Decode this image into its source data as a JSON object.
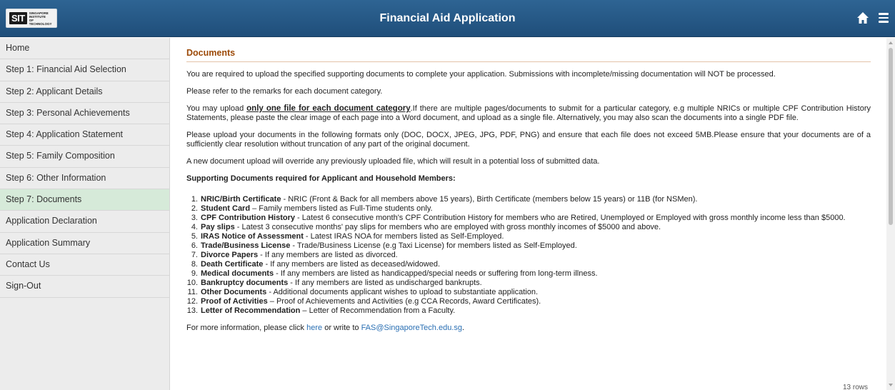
{
  "header": {
    "logo_mark": "SIT",
    "logo_text": "SINGAPORE INSTITUTE OF TECHNOLOGY",
    "title": "Financial Aid Application",
    "home_icon": "home-icon",
    "menu_icon": "hamburger-menu-icon",
    "colors": {
      "bar": "#2a5c8a",
      "title_text": "#ffffff"
    }
  },
  "sidebar": {
    "items": [
      {
        "label": "Home",
        "active": false
      },
      {
        "label": "Step 1: Financial Aid Selection",
        "active": false
      },
      {
        "label": "Step 2: Applicant Details",
        "active": false
      },
      {
        "label": "Step 3: Personal Achievements",
        "active": false
      },
      {
        "label": "Step 4: Application Statement",
        "active": false
      },
      {
        "label": "Step 5: Family Composition",
        "active": false
      },
      {
        "label": "Step 6: Other Information",
        "active": false
      },
      {
        "label": "Step 7: Documents",
        "active": true
      },
      {
        "label": "Application Declaration",
        "active": false
      },
      {
        "label": "Application Summary",
        "active": false
      },
      {
        "label": "Contact Us",
        "active": false
      },
      {
        "label": "Sign-Out",
        "active": false
      }
    ],
    "colors": {
      "background": "#ececec",
      "active": "#d6ead9"
    }
  },
  "main": {
    "section_title": "Documents",
    "p1": "You are required to upload the specified supporting documents to complete your application. Submissions with incomplete/missing documentation will NOT be processed.",
    "p2": "Please refer to the remarks for each document category.",
    "p3_pre": "You may upload ",
    "p3_bold": "only one file for each document category",
    "p3_post": ".If there are multiple pages/documents to submit for a particular category, e.g multiple NRICs or multiple CPF Contribution History Statements, please paste the clear image of each page into a Word document, and upload as a single file. Alternatively, you may also scan the documents into a single PDF file.",
    "p4": "Please upload your documents in the following formats only (DOC, DOCX, JPEG, JPG, PDF, PNG) and ensure that each file does not exceed 5MB.Please ensure that your documents are of a sufficiently clear resolution without truncation of any part of the original document.",
    "p5": "A new document upload will override any previously uploaded file, which will result in a potential loss of submitted data.",
    "list_heading": "Supporting Documents required for Applicant and Household Members:",
    "documents": [
      {
        "num": "1.",
        "name": "NRIC/Birth Certificate",
        "desc": " - NRIC (Front & Back for all members above 15 years), Birth Certificate (members below 15 years) or 11B (for NSMen)."
      },
      {
        "num": "2.",
        "name": "Student Card",
        "desc": " – Family members listed as Full-Time students only."
      },
      {
        "num": "3.",
        "name": "CPF Contribution History",
        "desc": " - Latest 6 consecutive month's CPF Contribution History for members who are Retired, Unemployed or Employed with gross monthly income less than $5000."
      },
      {
        "num": "4.",
        "name": "Pay slips",
        "desc": " - Latest 3 consecutive months' pay slips for members who are employed with gross monthly incomes of $5000 and above."
      },
      {
        "num": "5.",
        "name": "IRAS Notice of Assessment",
        "desc": " - Latest IRAS NOA for members listed as Self-Employed."
      },
      {
        "num": "6.",
        "name": "Trade/Business License",
        "desc": " - Trade/Business License (e.g Taxi License) for members listed as Self-Employed."
      },
      {
        "num": "7.",
        "name": "Divorce Papers",
        "desc": " - If any members are listed as divorced."
      },
      {
        "num": "8.",
        "name": "Death Certificate",
        "desc": " - If any members are listed as deceased/widowed."
      },
      {
        "num": "9.",
        "name": "Medical documents",
        "desc": " - If any members are listed as handicapped/special needs or suffering from long-term illness."
      },
      {
        "num": "10.",
        "name": "Bankruptcy documents",
        "desc": " - If any members are listed as undischarged bankrupts."
      },
      {
        "num": "11.",
        "name": "Other Documents",
        "desc": " - Additional documents applicant wishes to upload to substantiate application."
      },
      {
        "num": "12.",
        "name": "Proof of Activities",
        "desc": " – Proof of Achievements and Activities (e.g CCA Records, Award Certificates)."
      },
      {
        "num": "13.",
        "name": "Letter of Recommendation",
        "desc": " – Letter of Recommendation from a Faculty."
      }
    ],
    "footer_pre": "For more information, please click ",
    "footer_link_here": "here",
    "footer_mid": " or write to ",
    "footer_email": "FAS@SingaporeTech.edu.sg",
    "footer_post": ".",
    "cut_text": "13 rows",
    "colors": {
      "section_title": "#9c4a08",
      "link": "#2a6fb3"
    }
  }
}
